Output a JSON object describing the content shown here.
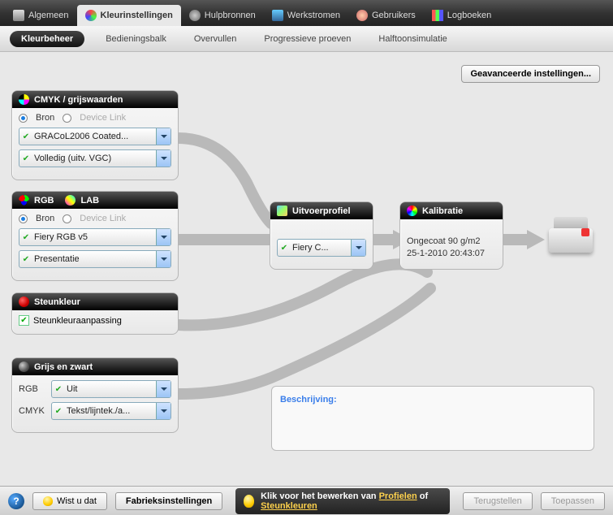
{
  "top_tabs": {
    "algemeen": "Algemeen",
    "kleuren": "Kleurinstellingen",
    "hulp": "Hulpbronnen",
    "werk": "Werkstromen",
    "gebruikers": "Gebruikers",
    "log": "Logboeken"
  },
  "sub_tabs": {
    "kleurbeheer": "Kleurbeheer",
    "bedieningsbalk": "Bedieningsbalk",
    "overvullen": "Overvullen",
    "progressieve": "Progressieve proeven",
    "halftoon": "Halftoonsimulatie"
  },
  "adv_button": "Geavanceerde instellingen...",
  "radio": {
    "bron": "Bron",
    "device_link": "Device Link"
  },
  "cmyk": {
    "title": "CMYK / grijswaarden",
    "profile": "GRACoL2006 Coated...",
    "intent": "Volledig (uitv. VGC)"
  },
  "rgb": {
    "title_rgb": "RGB",
    "title_lab": "LAB",
    "profile": "Fiery RGB v5",
    "intent": "Presentatie"
  },
  "steunkleur": {
    "title": "Steunkleur",
    "check": "Steunkleuraanpassing"
  },
  "grijs": {
    "title": "Grijs en zwart",
    "rgb_label": "RGB",
    "rgb_value": "Uit",
    "cmyk_label": "CMYK",
    "cmyk_value": "Tekst/lijntek./a..."
  },
  "output": {
    "title": "Uitvoerprofiel",
    "value": "Fiery C..."
  },
  "kalibratie": {
    "title": "Kalibratie",
    "line1": "Ongecoat 90 g/m2",
    "line2": "25-1-2010 20:43:07"
  },
  "description": {
    "label": "Beschrijving:"
  },
  "footer": {
    "wist": "Wist u dat",
    "fabriek": "Fabrieksinstellingen",
    "tip_pre": "Klik voor het bewerken van",
    "tip_link1": "Profielen",
    "tip_of": "of",
    "tip_link2": "Steunkleuren",
    "terug": "Terugstellen",
    "toepassen": "Toepassen"
  }
}
